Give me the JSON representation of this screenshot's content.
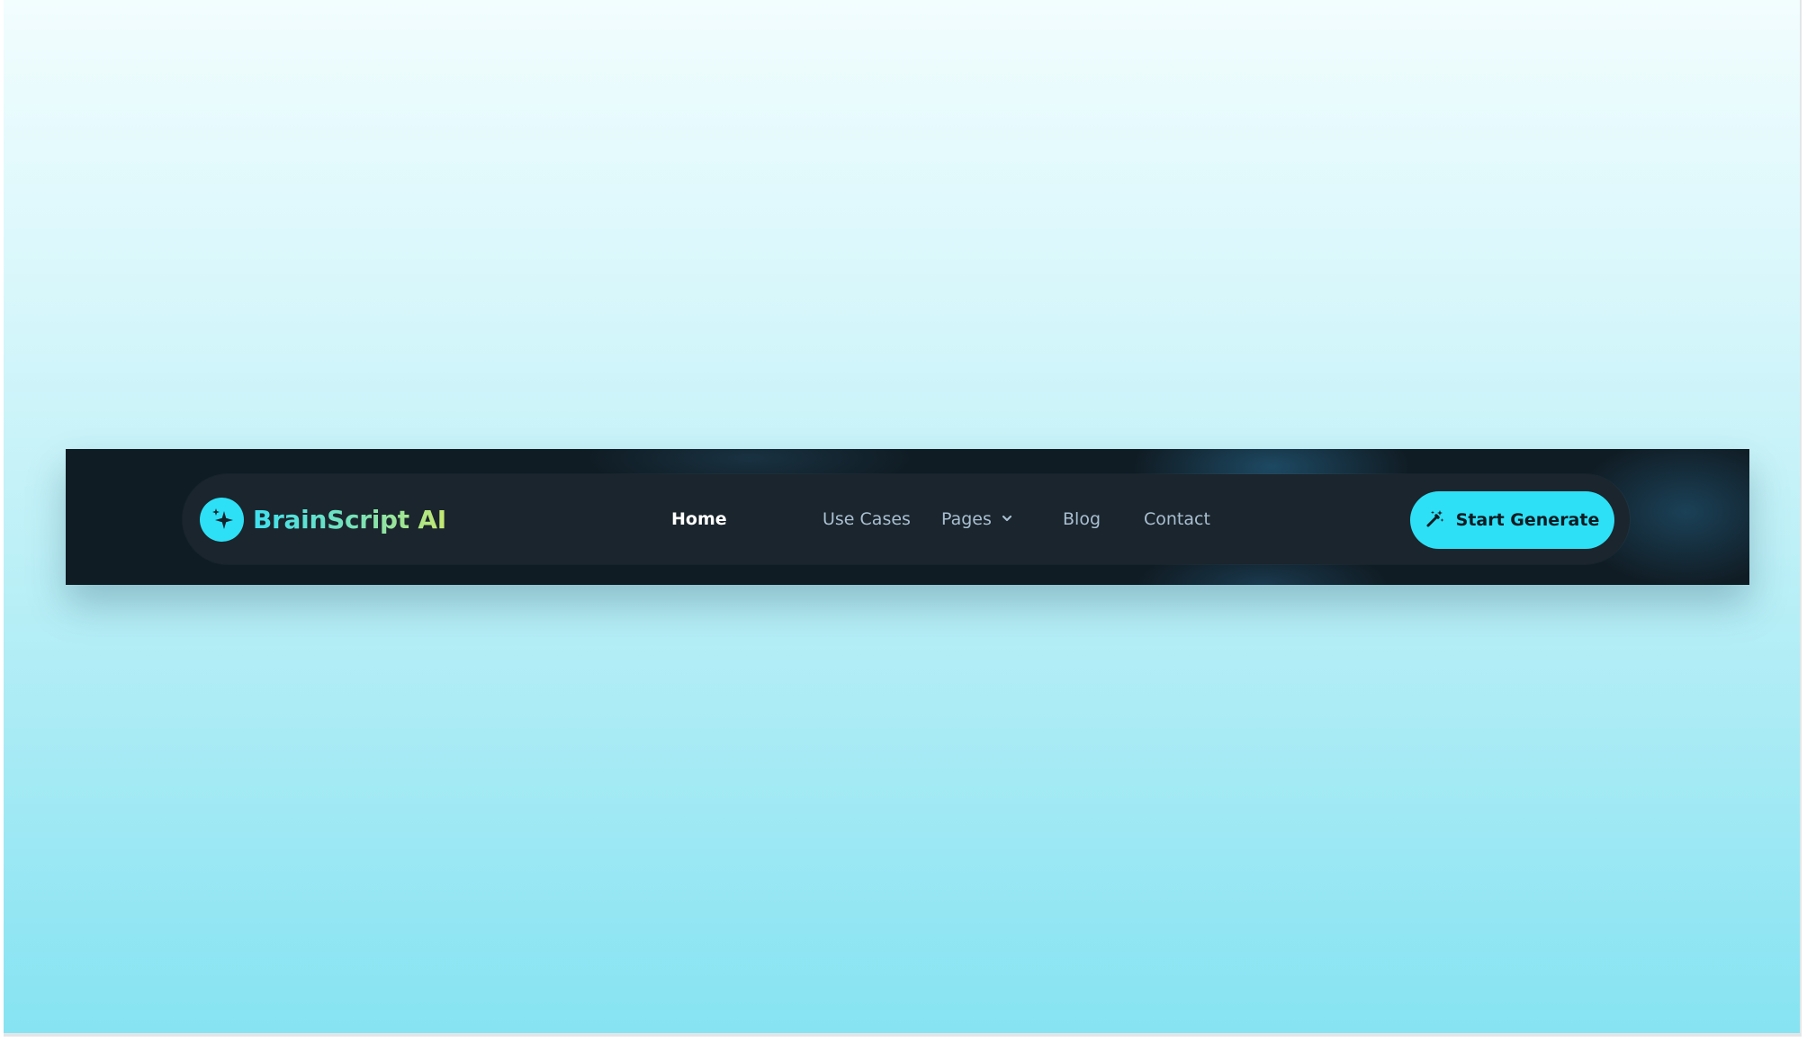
{
  "brand": {
    "name": "BrainScript AI",
    "logo_icon": "sparkle-icon",
    "accent_color": "#2de0f6"
  },
  "nav": {
    "items": [
      {
        "label": "Home",
        "active": true
      },
      {
        "label": "Use Cases",
        "active": false
      },
      {
        "label": "Pages",
        "active": false,
        "has_dropdown": true,
        "icon": "chevron-down-icon"
      },
      {
        "label": "Blog",
        "active": false
      },
      {
        "label": "Contact",
        "active": false
      }
    ]
  },
  "cta": {
    "label": "Start Generate",
    "icon": "magic-wand-icon"
  },
  "colors": {
    "bar_background": "#101c24",
    "navbar_background": "#1b252d",
    "link_color": "#a9bfd1",
    "active_link_color": "#ffffff"
  }
}
